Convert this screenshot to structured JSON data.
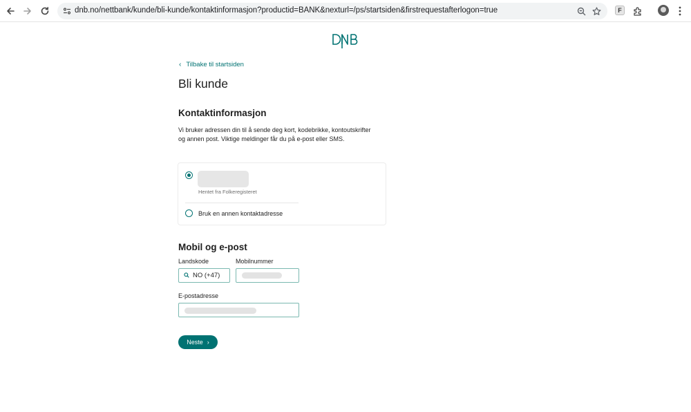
{
  "browser": {
    "url": "dnb.no/nettbank/kunde/bli-kunde/kontaktinformasjon?productid=BANK&nexturl=/ps/startsiden&firstrequestafterlogon=true",
    "extension_label": "F"
  },
  "logo": {
    "text": "DNB",
    "color": "#007272"
  },
  "back_link": "Tilbake til startsiden",
  "page_title": "Bli kunde",
  "contact": {
    "title": "Kontaktinformasjon",
    "description": "Vi bruker adressen din til å sende deg kort, kodebrikke, kontoutskrifter og annen post. Viktige meldinger får du på e-post eller SMS.",
    "options": [
      {
        "sublabel": "Hentet fra Folkeregisteret",
        "selected": true
      },
      {
        "label": "Bruk en annen kontaktadresse",
        "selected": false
      }
    ]
  },
  "mobile": {
    "title": "Mobil og e-post",
    "country_label": "Landskode",
    "country_value": "NO (+47)",
    "phone_label": "Mobilnummer",
    "email_label": "E-postadresse"
  },
  "next_button": "Neste",
  "colors": {
    "accent": "#007272",
    "input_border": "#7ab8b0"
  }
}
